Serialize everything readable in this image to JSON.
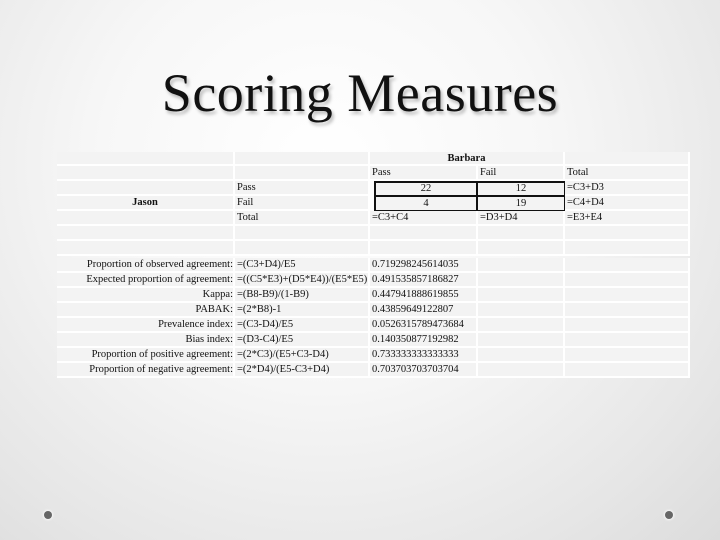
{
  "slide": {
    "title": "Scoring Measures"
  },
  "table": {
    "rater_row_label": "Jason",
    "rater_col_label": "Barbara",
    "col_headers": [
      "Pass",
      "Fail",
      "Total"
    ],
    "row_headers": [
      "Pass",
      "Fail",
      "Total"
    ],
    "cells": {
      "pass_pass": "22",
      "pass_fail": "12",
      "pass_total": "=C3+D3",
      "fail_pass": "4",
      "fail_fail": "19",
      "fail_total": "=C4+D4",
      "total_pass": "=C3+C4",
      "total_fail": "=D3+D4",
      "total_total": "=E3+E4"
    }
  },
  "measures": [
    {
      "label": "Proportion of observed agreement:",
      "formula": "=(C3+D4)/E5",
      "value": "0.719298245614035"
    },
    {
      "label": "Expected proportion of agreement:",
      "formula": "=((C5*E3)+(D5*E4))/(E5*E5)",
      "value": "0.491535857186827"
    },
    {
      "label": "Kappa:",
      "formula": "=(B8-B9)/(1-B9)",
      "value": "0.447941888619855"
    },
    {
      "label": "PABAK:",
      "formula": "=(2*B8)-1",
      "value": "0.43859649122807"
    },
    {
      "label": "Prevalence index:",
      "formula": "=(C3-D4)/E5",
      "value": "0.0526315789473684"
    },
    {
      "label": "Bias index:",
      "formula": "=(D3-C4)/E5",
      "value": "0.140350877192982"
    },
    {
      "label": "Proportion of positive agreement:",
      "formula": "=(2*C3)/(E5+C3-D4)",
      "value": "0.733333333333333"
    },
    {
      "label": "Proportion of negative agreement:",
      "formula": "=(2*D4)/(E5-C3+D4)",
      "value": "0.703703703703704"
    }
  ]
}
